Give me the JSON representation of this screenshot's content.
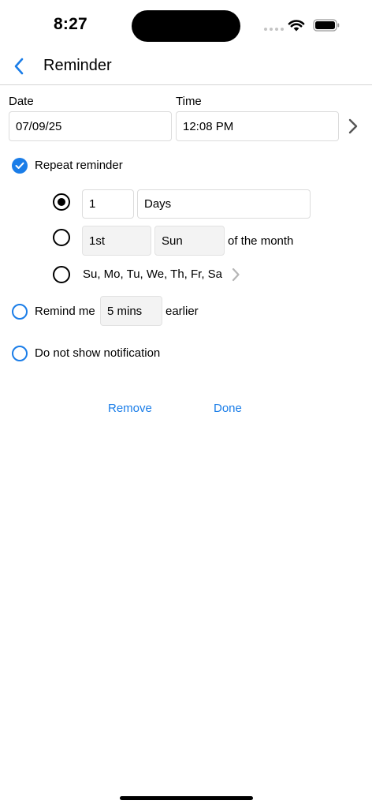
{
  "status_bar": {
    "time": "8:27"
  },
  "nav": {
    "title": "Reminder"
  },
  "date_section": {
    "date_label": "Date",
    "date_value": "07/09/25",
    "time_label": "Time",
    "time_value": "12:08 PM"
  },
  "repeat": {
    "label": "Repeat reminder",
    "checked": true,
    "option_interval": {
      "selected": true,
      "count": "1",
      "unit": "Days"
    },
    "option_monthly": {
      "selected": false,
      "ordinal": "1st",
      "weekday": "Sun",
      "suffix": "of the month"
    },
    "option_weekdays": {
      "selected": false,
      "days": "Su, Mo, Tu, We, Th, Fr, Sa"
    }
  },
  "remind_me": {
    "prefix": "Remind me",
    "value": "5 mins",
    "suffix": "earlier",
    "selected": false
  },
  "no_notification": {
    "label": "Do not show notification",
    "selected": false
  },
  "actions": {
    "remove_label": "Remove",
    "done_label": "Done"
  },
  "colors": {
    "accent": "#1a7de8",
    "border": "#dcdcdc",
    "disabled_bg": "#f3f3f3"
  },
  "icons": [
    "back-chevron-icon",
    "chevron-right-icon",
    "checkmark-icon",
    "wifi-icon",
    "battery-icon",
    "signal-icon"
  ]
}
